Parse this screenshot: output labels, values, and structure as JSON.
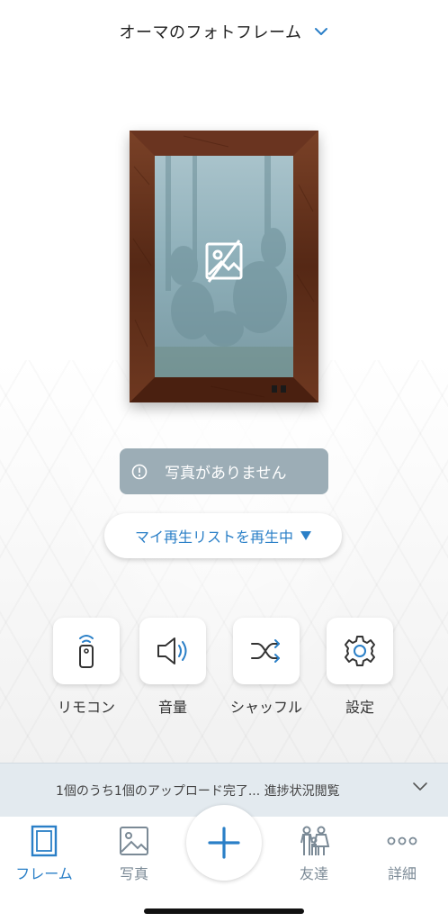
{
  "header": {
    "title": "オーマのフォトフレーム",
    "chevron_icon": "chevron-down-icon"
  },
  "frame": {
    "status": "写真がありません",
    "status_icon": "info-icon",
    "photo_icon": "no-photo-icon"
  },
  "playlist": {
    "label": "マイ再生リストを再生中",
    "arrow_icon": "triangle-down-icon"
  },
  "controls": [
    {
      "label": "リモコン",
      "icon": "remote-icon"
    },
    {
      "label": "音量",
      "icon": "volume-icon"
    },
    {
      "label": "シャッフル",
      "icon": "shuffle-icon"
    },
    {
      "label": "設定",
      "icon": "gear-icon"
    }
  ],
  "upload_bar": {
    "text": "1個のうち1個のアップロード完了... 進捗状況閲覧",
    "chevron_icon": "chevron-down-icon"
  },
  "tabbar": {
    "tabs": [
      {
        "label": "フレーム",
        "icon": "frame-icon",
        "active": true
      },
      {
        "label": "写真",
        "icon": "photo-icon",
        "active": false
      },
      {
        "label": "友達",
        "icon": "friends-icon",
        "active": false
      },
      {
        "label": "詳細",
        "icon": "more-icon",
        "active": false
      }
    ],
    "add_icon": "plus-icon"
  },
  "colors": {
    "accent": "#2a7fc7",
    "status_bg": "#9cadb6",
    "upload_bar_bg": "#e3eaef",
    "inactive_tab": "#7b8a96",
    "frame_wood": "#5a2c18"
  }
}
